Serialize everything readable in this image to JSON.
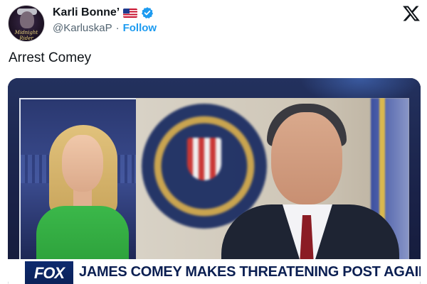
{
  "tweet": {
    "author": {
      "display_name": "Karli Bonne’",
      "handle": "@KarluskaP",
      "separator": "·",
      "follow_label": "Follow",
      "verified": true,
      "flag_icon": "us-flag-icon",
      "verified_icon": "verified-badge-icon",
      "avatar_text": "Midnight Rider"
    },
    "text": "Arrest Comey",
    "media": {
      "network_logo_text": "FOX",
      "headline": "JAMES COMEY MAKES THREATENING POST AGAINST TRUMP"
    }
  },
  "app": {
    "logo_icon": "x-logo-icon"
  },
  "colors": {
    "link_blue": "#1d9bf0",
    "text_primary": "#0f1419",
    "text_secondary": "#536471",
    "headline_navy": "#0b1f52"
  }
}
